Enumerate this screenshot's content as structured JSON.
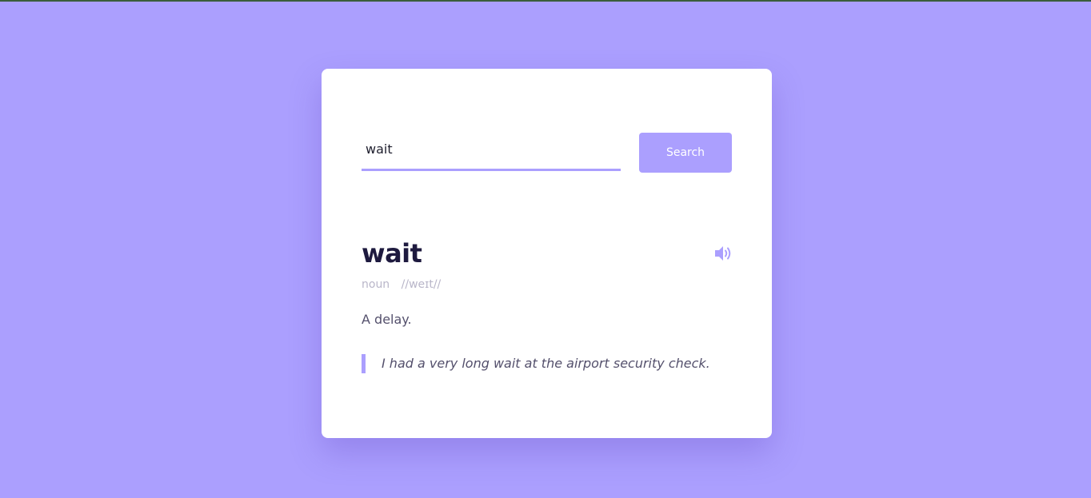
{
  "search": {
    "value": "wait",
    "button_label": "Search"
  },
  "result": {
    "word": "wait",
    "part_of_speech": "noun",
    "phonetic": "//weɪt//",
    "definition": "A delay.",
    "example": "I had a very long wait at the airport security check.",
    "audio_icon": "speaker-icon"
  },
  "colors": {
    "accent": "#ab9ffe",
    "title": "#1e1a3f",
    "muted": "#b9b6c9",
    "text": "#54506c",
    "card": "#ffffff"
  }
}
